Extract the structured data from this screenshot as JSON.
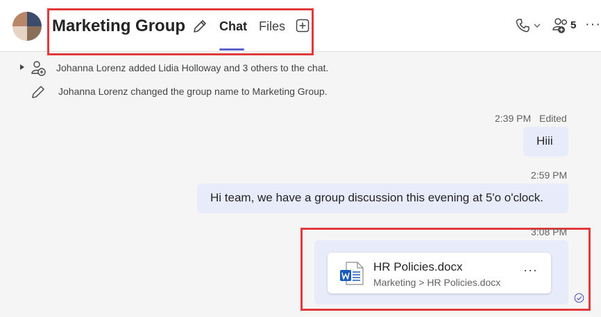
{
  "header": {
    "title": "Marketing Group",
    "tabs": [
      {
        "label": "Chat",
        "active": true
      },
      {
        "label": "Files",
        "active": false
      }
    ],
    "participant_count": "5",
    "more_label": "···"
  },
  "system_messages": [
    {
      "text": "Johanna Lorenz added Lidia Holloway and 3 others to the chat.",
      "icon": "add-person-icon"
    },
    {
      "text": "Johanna Lorenz changed the group name to Marketing Group.",
      "icon": "pencil-icon"
    }
  ],
  "messages": [
    {
      "time": "2:39 PM",
      "status": "Edited",
      "text": "Hiii"
    },
    {
      "time": "2:59 PM",
      "text": "Hi team, we have a group discussion this evening at 5'o o'clock."
    },
    {
      "time": "3:08 PM",
      "file": {
        "name": "HR Policies.docx",
        "path": "Marketing > HR Policies.docx",
        "more_label": "···",
        "icon": "word-doc-icon"
      }
    }
  ],
  "colors": {
    "accent": "#5b5fc7",
    "bubble": "#e8ebfa",
    "annotation": "#e23a3a",
    "word_blue": "#185abd"
  }
}
